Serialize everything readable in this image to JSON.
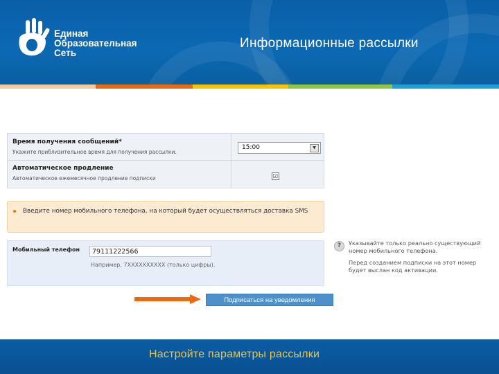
{
  "header": {
    "brand_line1": "Единая",
    "brand_line2": "Образовательная",
    "brand_line3": "Сеть",
    "title": "Информационные рассылки",
    "stripe_colors": [
      "#f2c9a2",
      "#e86a12",
      "#f5c400",
      "#8dc63f",
      "#1ea0d8"
    ]
  },
  "form": {
    "time_label": "Время получения сообщений*",
    "time_sub": "Укажите приблизительное время для получения рассылки.",
    "time_value": "15:00",
    "renew_label": "Автоматическое продление",
    "renew_sub": "Автоматическое ежемесячное продление подписки",
    "renew_checked": "☑"
  },
  "notice": {
    "text": "Введите номер мобильного телефона, на который будет осуществляться доставка SMS"
  },
  "phone": {
    "label": "Мобильный телефон",
    "value": "79111222566",
    "hint": "Например, 7XXXXXXXXXX (только цифры)."
  },
  "help": {
    "icon": "question-icon",
    "text1": "Указывайте только реально существующий номер мобильного телефона.",
    "text2": "Перед созданием подписки на этот номер будет выслан код активации."
  },
  "subscribe_label": "Подписаться на уведомления",
  "footer": {
    "caption": "Настройте параметры рассылки"
  }
}
